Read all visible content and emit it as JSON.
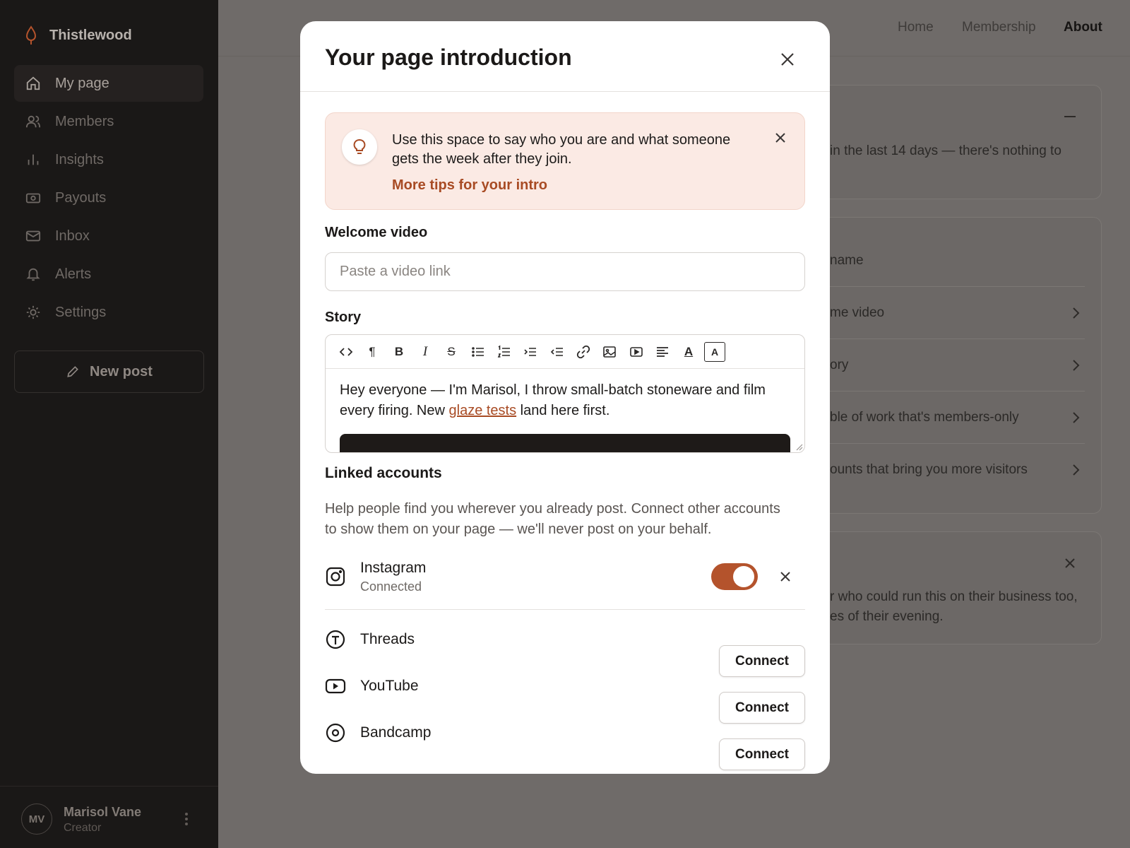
{
  "sidebar": {
    "brand": "Thistlewood",
    "items": [
      {
        "label": "My page",
        "icon": "home-icon"
      },
      {
        "label": "Members",
        "icon": "users-icon"
      },
      {
        "label": "Insights",
        "icon": "bar-chart-icon"
      },
      {
        "label": "Payouts",
        "icon": "payout-icon"
      },
      {
        "label": "Inbox",
        "icon": "mail-icon"
      },
      {
        "label": "Alerts",
        "icon": "bell-icon"
      },
      {
        "label": "Settings",
        "icon": "gear-icon"
      }
    ],
    "new_post": "New post",
    "profile": {
      "initials": "MV",
      "name": "Marisol Vane",
      "role": "Creator"
    }
  },
  "topnav": {
    "home": "Home",
    "membership": "Membership",
    "about": "About"
  },
  "background": {
    "card1_text": "in the last 14 days — there's nothing to",
    "card2_rows": [
      "name",
      "me video",
      "ory",
      "ble of work that's members-only",
      "ounts that bring you more visitors"
    ],
    "card3_text": [
      "r who could run this on their business too,",
      "es of their evening."
    ]
  },
  "modal": {
    "title": "Your page introduction",
    "tip": {
      "text": "Use this space to say who you are and what someone gets the week after they join.",
      "link": "More tips for your intro"
    },
    "welcome_video": {
      "label": "Welcome video",
      "placeholder": "Paste a video link",
      "value": ""
    },
    "story": {
      "label": "Story",
      "text_before": "Hey everyone — I'm Marisol, I throw small-batch stoneware and film every firing. New ",
      "link": "glaze tests",
      "text_after": " land here first."
    },
    "linked": {
      "title": "Linked accounts",
      "description": "Help people find you wherever you already post. Connect other accounts to show them on your page — we'll never post on your behalf.",
      "accounts": [
        {
          "name": "Instagram",
          "status": "Connected",
          "enabled": true
        },
        {
          "name": "Threads",
          "action": "Connect"
        },
        {
          "name": "YouTube",
          "action": "Connect"
        },
        {
          "name": "Bandcamp",
          "action": "Connect"
        }
      ]
    }
  },
  "colors": {
    "accent": "#b4532c",
    "tip_bg": "#fbeae4",
    "link": "#a84b24",
    "sidebar_bg": "#1a1817"
  }
}
